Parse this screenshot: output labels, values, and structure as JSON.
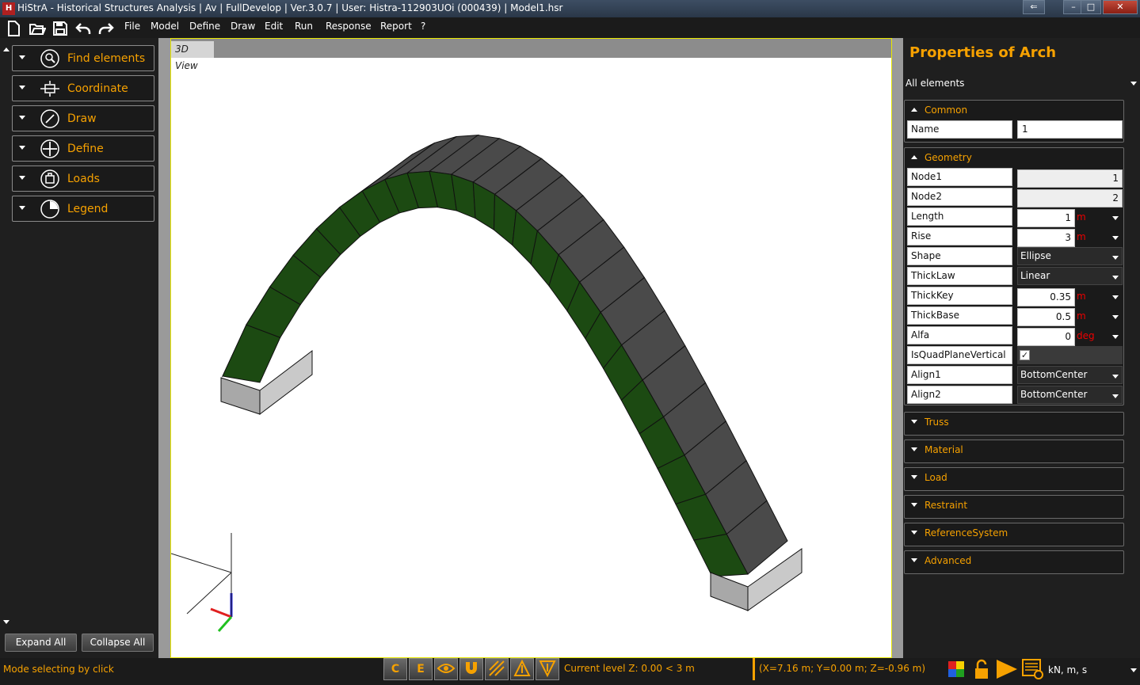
{
  "window": {
    "title": "HiStrA - Historical Structures Analysis | Av | FullDevelop | Ver.3.0.7 | User: Histra-112903UOi (000439) | Model1.hsr",
    "app_icon_text": "H",
    "minimize": "–",
    "restore": "□",
    "close": "✕",
    "back_label": "⇐"
  },
  "menu": [
    "File",
    "Model",
    "Define",
    "Draw",
    "Edit",
    "Run",
    "Response",
    "Report",
    "?"
  ],
  "left_panel": {
    "items": [
      {
        "label": "Find elements",
        "icon": "search-icon"
      },
      {
        "label": "Coordinate",
        "icon": "coordinate-icon"
      },
      {
        "label": "Draw",
        "icon": "draw-icon"
      },
      {
        "label": "Define",
        "icon": "define-icon"
      },
      {
        "label": "Loads",
        "icon": "loads-icon"
      },
      {
        "label": "Legend",
        "icon": "legend-icon"
      }
    ],
    "expand_all": "Expand All",
    "collapse_all": "Collapse All"
  },
  "view": {
    "tab": "3D View"
  },
  "properties": {
    "title": "Properties of Arch",
    "filter": "All elements",
    "sections": {
      "common": "Common",
      "geometry": "Geometry",
      "truss": "Truss",
      "material": "Material",
      "load": "Load",
      "restraint": "Restraint",
      "reference_system": "ReferenceSystem",
      "advanced": "Advanced"
    },
    "common": {
      "name_label": "Name",
      "name_value": "1"
    },
    "geometry": {
      "node1_label": "Node1",
      "node1_value": "1",
      "node2_label": "Node2",
      "node2_value": "2",
      "length_label": "Length",
      "length_value": "1",
      "length_unit": "m",
      "rise_label": "Rise",
      "rise_value": "3",
      "rise_unit": "m",
      "shape_label": "Shape",
      "shape_value": "Ellipse",
      "thicklaw_label": "ThickLaw",
      "thicklaw_value": "Linear",
      "thickkey_label": "ThickKey",
      "thickkey_value": "0.35",
      "thickkey_unit": "m",
      "thickbase_label": "ThickBase",
      "thickbase_value": "0.5",
      "thickbase_unit": "m",
      "alfa_label": "Alfa",
      "alfa_value": "0",
      "alfa_unit": "deg",
      "isquad_label": "IsQuadPlaneVertical",
      "isquad_checked": true,
      "align1_label": "Align1",
      "align1_value": "BottomCenter",
      "align2_label": "Align2",
      "align2_value": "BottomCenter"
    }
  },
  "status": {
    "mode": "Mode selecting by click",
    "btn_c": "C",
    "btn_e": "E",
    "level": "Current level Z: 0.00 < 3 m",
    "coords": "(X=7.16 m; Y=0.00 m; Z=-0.96 m)",
    "units": "kN, m, s"
  },
  "colors": {
    "accent": "#f6a100",
    "arch_face": "#1c4a12",
    "arch_top": "#4a4a4a",
    "support": "#a8a8a8"
  }
}
